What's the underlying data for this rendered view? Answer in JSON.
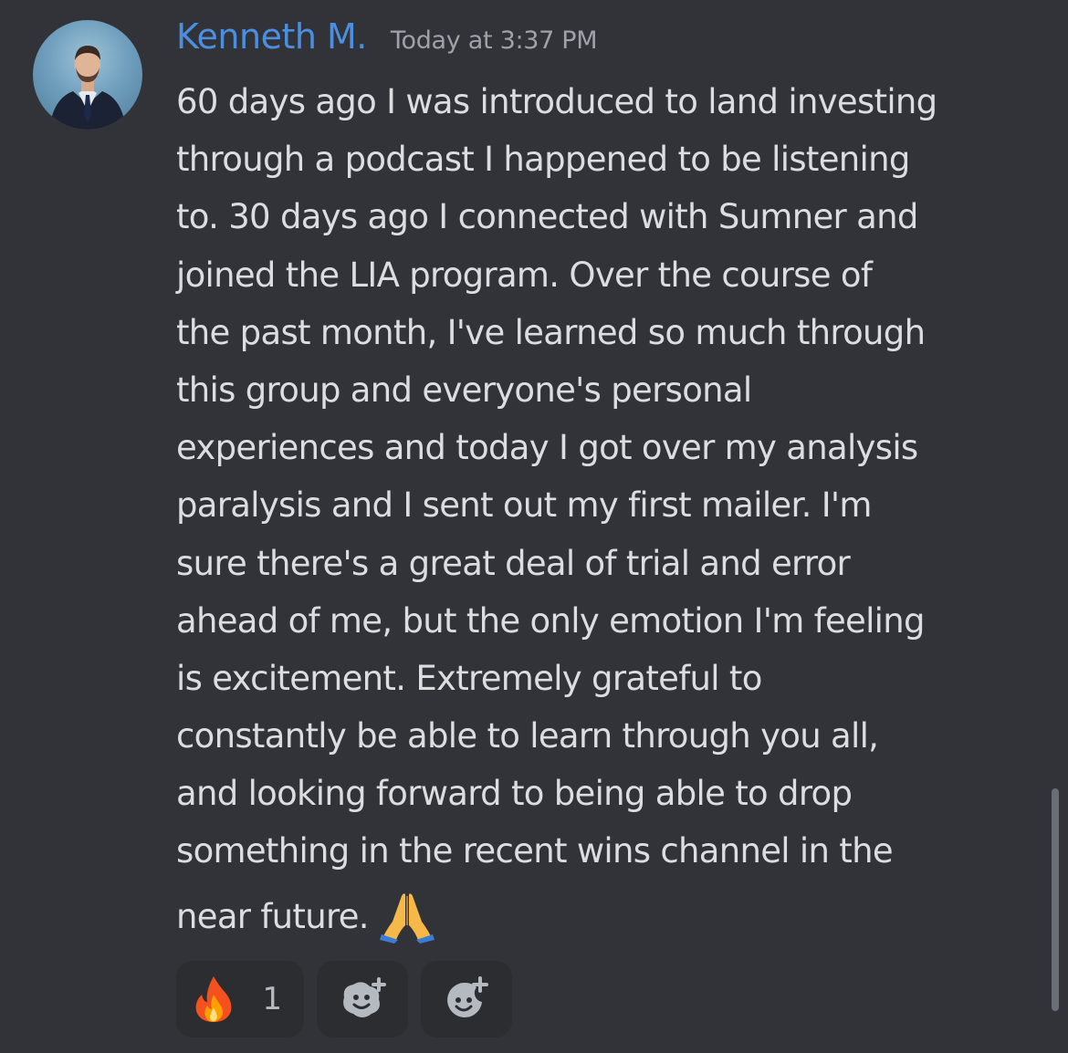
{
  "message": {
    "username": "Kenneth M.",
    "timestamp": "Today at 3:37 PM",
    "avatar_icon": "user-avatar-icon",
    "lines": [
      "60 days ago I was introduced to land investing",
      "through a podcast I happened to be listening",
      "to. 30 days ago I connected with Sumner and",
      "joined the LIA program. Over the course of",
      "the past month, I've learned so much through",
      "this group and everyone's personal",
      "experiences and today I got over my analysis",
      "paralysis and I sent out my first mailer. I'm",
      "sure there's a great deal of trial and error",
      "ahead of me, but the only emotion I'm feeling",
      "is excitement. Extremely grateful to",
      "constantly be able to learn through you all,",
      "and looking forward to being able to drop",
      "something in the recent wins channel in the"
    ],
    "last_line": "near future.",
    "end_emoji": "folded-hands-icon"
  },
  "reactions": [
    {
      "icon": "fire-icon",
      "count": "1"
    },
    {
      "icon": "add-super-reaction-icon"
    },
    {
      "icon": "add-reaction-icon"
    }
  ],
  "colors": {
    "background": "#313338",
    "username": "#4c8fe0",
    "text": "#dbdee1",
    "timestamp": "#a0a2aa",
    "reaction_bg": "#2b2d31"
  }
}
